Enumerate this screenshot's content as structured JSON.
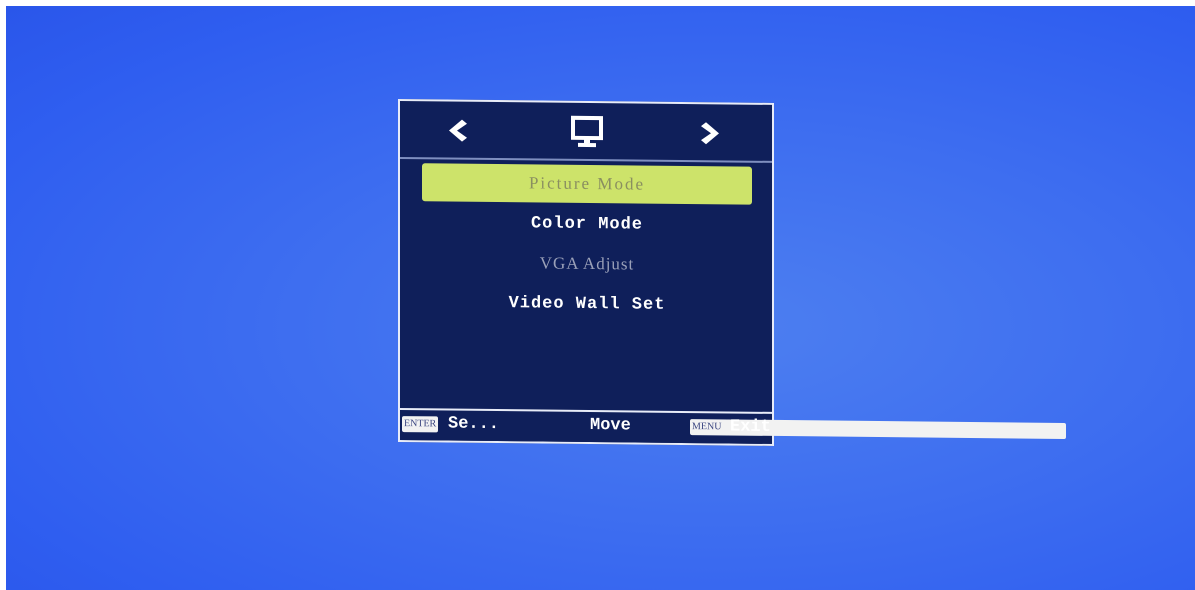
{
  "osd": {
    "nav": {
      "left_icon": "chevron-left-icon",
      "center_icon": "monitor-icon",
      "right_icon": "chevron-right-icon"
    },
    "menu": {
      "items": [
        {
          "label": "Picture Mode",
          "state": "selected"
        },
        {
          "label": "Color Mode",
          "state": "normal"
        },
        {
          "label": "VGA Adjust",
          "state": "disabled"
        },
        {
          "label": "Video Wall Set",
          "state": "normal"
        }
      ]
    },
    "footer": {
      "enter_key": "ENTER",
      "select_label": "Se...",
      "move_label": "Move",
      "menu_key": "MENU",
      "exit_label": "Exit"
    }
  },
  "colors": {
    "screen_background": "#3d6df0",
    "osd_background": "#0f1f5a",
    "selected_highlight": "#cde36a",
    "disabled_text": "#9aa0b8"
  }
}
